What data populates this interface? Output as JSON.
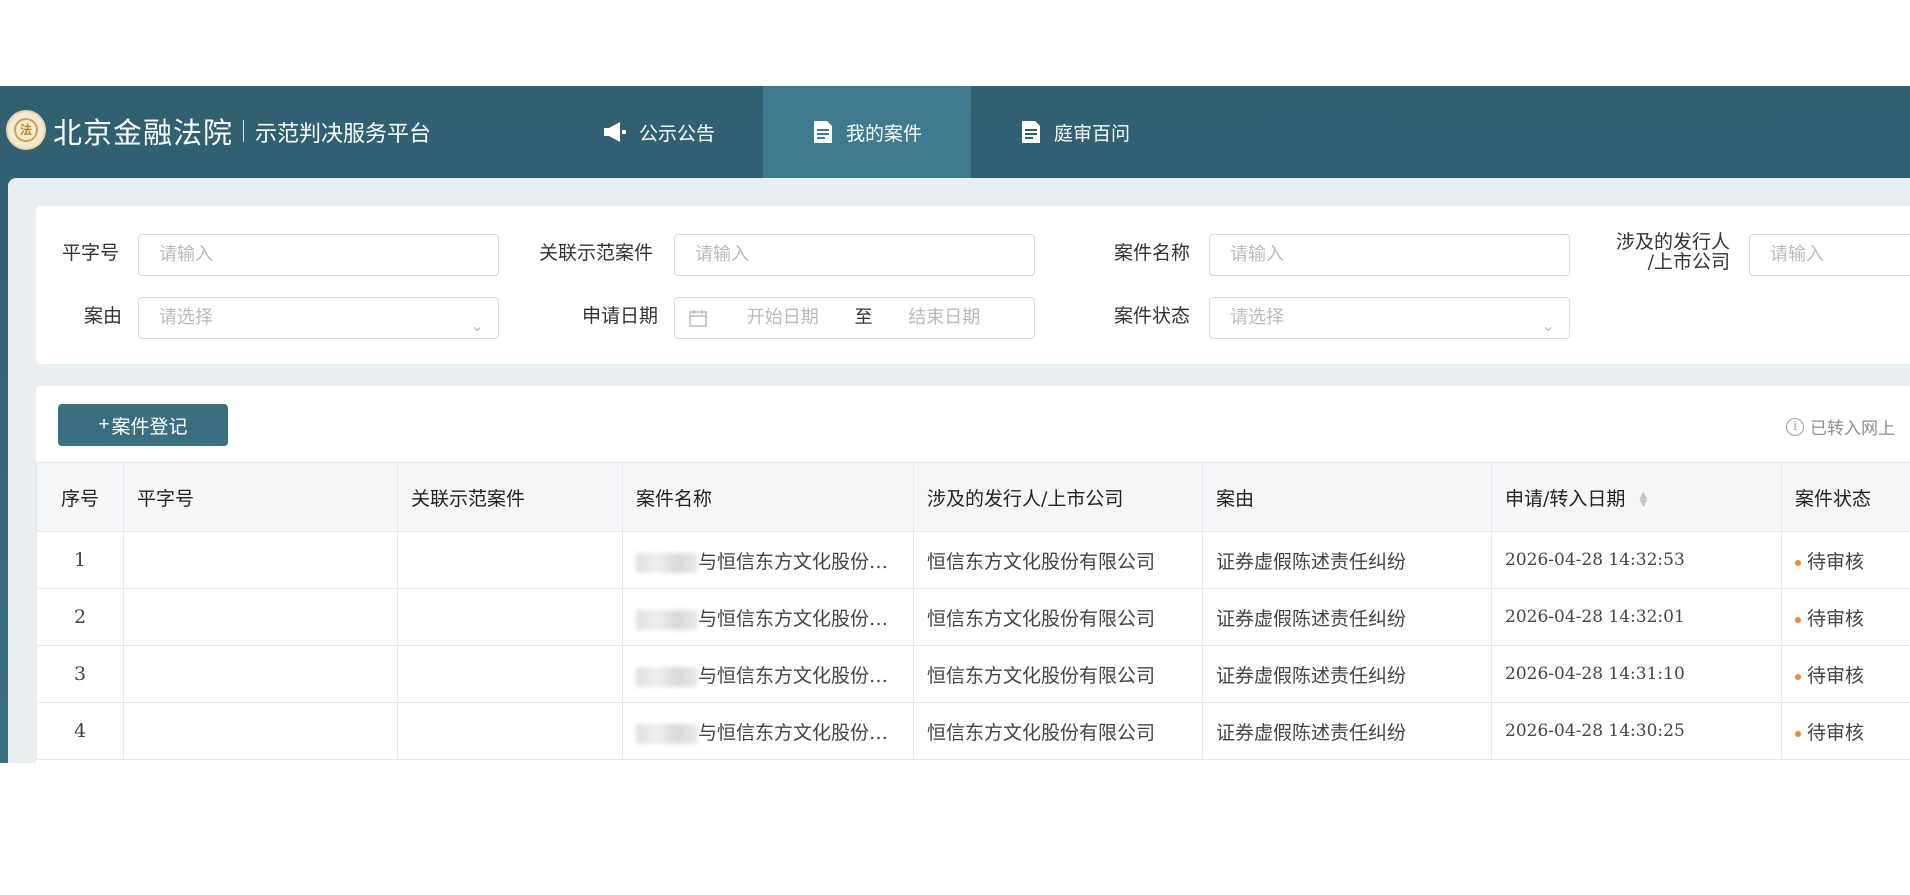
{
  "header": {
    "title": "北京金融法院",
    "subtitle": "示范判决服务平台",
    "tabs": [
      {
        "label": "公示公告",
        "icon": "megaphone-icon",
        "active": false
      },
      {
        "label": "我的案件",
        "icon": "document-icon",
        "active": true
      },
      {
        "label": "庭审百问",
        "icon": "document-icon",
        "active": false
      }
    ]
  },
  "filters": {
    "case_no_label": "平字号",
    "case_no_placeholder": "请输入",
    "related_label": "关联示范案件",
    "related_placeholder": "请输入",
    "case_name_label": "案件名称",
    "case_name_placeholder": "请输入",
    "issuer_label_line1": "涉及的发行人",
    "issuer_label_line2": "/上市公司",
    "issuer_placeholder": "请输入",
    "cause_label": "案由",
    "cause_placeholder": "请选择",
    "date_label": "申请日期",
    "date_start_placeholder": "开始日期",
    "date_separator": "至",
    "date_end_placeholder": "结束日期",
    "status_label": "案件状态",
    "status_placeholder": "请选择"
  },
  "toolbar": {
    "add_label": "案件登记",
    "notice": "已转入网上"
  },
  "table": {
    "columns": [
      "序号",
      "平字号",
      "关联示范案件",
      "案件名称",
      "涉及的发行人/上市公司",
      "案由",
      "申请/转入日期",
      "案件状态"
    ],
    "rows": [
      {
        "idx": "1",
        "case_no": "",
        "related": "",
        "name": "与恒信东方文化股份…",
        "issuer": "恒信东方文化股份有限公司",
        "cause": "证券虚假陈述责任纠纷",
        "date": "2026-04-28 14:32:53",
        "status": "待审核"
      },
      {
        "idx": "2",
        "case_no": "",
        "related": "",
        "name": "与恒信东方文化股份…",
        "issuer": "恒信东方文化股份有限公司",
        "cause": "证券虚假陈述责任纠纷",
        "date": "2026-04-28 14:32:01",
        "status": "待审核"
      },
      {
        "idx": "3",
        "case_no": "",
        "related": "",
        "name": "与恒信东方文化股份…",
        "issuer": "恒信东方文化股份有限公司",
        "cause": "证券虚假陈述责任纠纷",
        "date": "2026-04-28 14:31:10",
        "status": "待审核"
      },
      {
        "idx": "4",
        "case_no": "",
        "related": "",
        "name": "与恒信东方文化股份…",
        "issuer": "恒信东方文化股份有限公司",
        "cause": "证券虚假陈述责任纠纷",
        "date": "2026-04-28 14:30:25",
        "status": "待审核"
      }
    ]
  },
  "colors": {
    "header_bg": "#2f5f70",
    "active_tab": "#3f7b8e",
    "primary_button": "#3a6f82",
    "status_dot": "#e98a3c"
  }
}
